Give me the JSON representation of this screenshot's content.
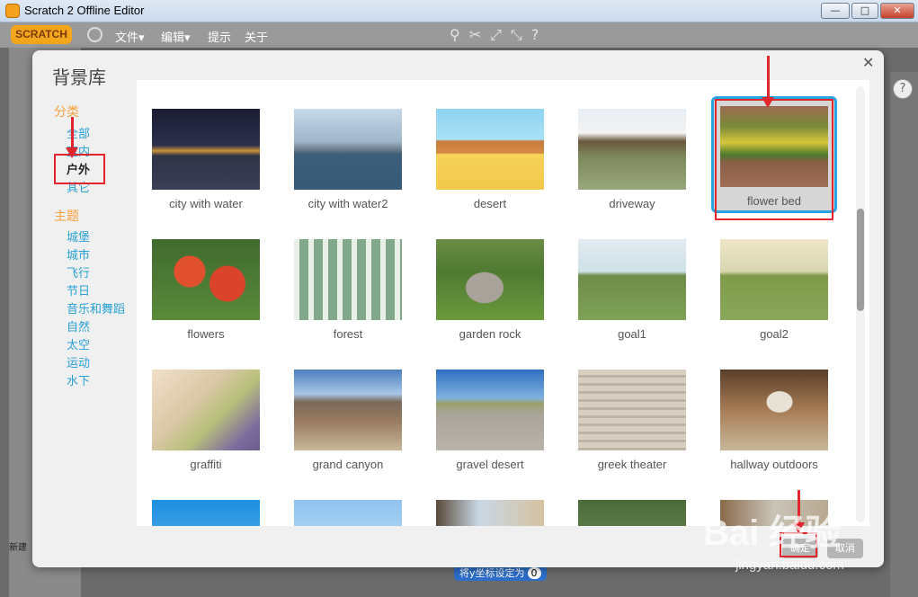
{
  "window": {
    "title": "Scratch 2 Offline Editor"
  },
  "menubar": {
    "logo": "SCRATCH",
    "items": [
      "文件▾",
      "编辑▾",
      "提示",
      "关于"
    ]
  },
  "background": {
    "new_label": "新建",
    "block_text": "将y坐标设定为",
    "block_value": "0"
  },
  "dialog": {
    "title": "背景库",
    "category_heading": "分类",
    "categories": [
      "全部",
      "室内",
      "户外",
      "其它"
    ],
    "selected_category": "户外",
    "theme_heading": "主题",
    "themes": [
      "城堡",
      "城市",
      "飞行",
      "节日",
      "音乐和舞蹈",
      "自然",
      "太空",
      "运动",
      "水下"
    ],
    "ok_label": "确定",
    "cancel_label": "取消"
  },
  "tiles": [
    {
      "label": "city with water",
      "icon": "city-skyline-night"
    },
    {
      "label": "city with water2",
      "icon": "city-skyline-day"
    },
    {
      "label": "desert",
      "icon": "cartoon-desert"
    },
    {
      "label": "driveway",
      "icon": "mansion-driveway"
    },
    {
      "label": "flower bed",
      "icon": "yellow-flowers",
      "selected": true
    },
    {
      "label": "flowers",
      "icon": "red-flowers"
    },
    {
      "label": "forest",
      "icon": "birch-forest"
    },
    {
      "label": "garden rock",
      "icon": "rock-on-grass"
    },
    {
      "label": "goal1",
      "icon": "soccer-goal"
    },
    {
      "label": "goal2",
      "icon": "soccer-goal-2"
    },
    {
      "label": "graffiti",
      "icon": "graffiti-wall"
    },
    {
      "label": "grand canyon",
      "icon": "canyon"
    },
    {
      "label": "gravel desert",
      "icon": "gravel-road"
    },
    {
      "label": "greek theater",
      "icon": "amphitheater"
    },
    {
      "label": "hallway outdoors",
      "icon": "arched-hallway"
    },
    {
      "label": "",
      "icon": "sky-partial"
    },
    {
      "label": "",
      "icon": "sky-partial-2"
    },
    {
      "label": "",
      "icon": "building-partial"
    },
    {
      "label": "",
      "icon": "trees-partial"
    },
    {
      "label": "",
      "icon": "building-partial-2"
    }
  ],
  "watermark": {
    "brand": "Bai 经验",
    "url": "jingyan.baidu.com"
  }
}
